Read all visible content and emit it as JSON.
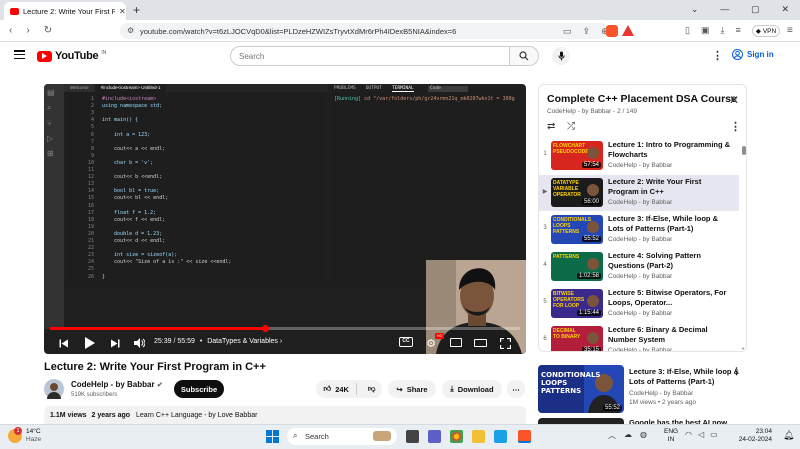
{
  "browser": {
    "tab_title": "Lecture 2: Write Your First Progr",
    "url": "youtube.com/watch?v=t6zLJOCVqD0&list=PLDzeHZWIZsTryvtXdMr6rPh4IDexB5NIA&index=6",
    "vpn_label": "VPN"
  },
  "header": {
    "logo_text": "YouTube",
    "country": "IN",
    "search_placeholder": "Search",
    "signin_label": "Sign in"
  },
  "video": {
    "tabs": [
      "Welcome",
      "#include<iostream> Untitled-1"
    ],
    "code_lines": [
      "#include<iostream>",
      "using namespace std;",
      "",
      "int main() {",
      "",
      "    int a = 123;",
      "",
      "    cout<< a << endl;",
      "",
      "    char b = 'v';",
      "",
      "    cout<< b <<endl;",
      "",
      "    bool bl = true;",
      "    cout<< bl << endl;",
      "",
      "    float f = 1.2;",
      "    cout<< f << endl;",
      "",
      "    double d = 1.23;",
      "    cout<< d << endl;",
      "",
      "    int size = sizeof(a);",
      "    cout<< \"Size of a is :\" << size <<endl;",
      "",
      "}"
    ],
    "panel_tabs": [
      "PROBLEMS",
      "OUTPUT",
      "TERMINAL"
    ],
    "panel_select": "Code",
    "terminal_running": "[Running]",
    "terminal_text": "cd \"/var/folders/ph/gr24vrmn21q_mk0207wkx1t = 300g",
    "time": "25:39 / 55:59",
    "chapter": "DataTypes & Variables",
    "progress": 0.458,
    "title": "Lecture 2: Write Your First Program in C++"
  },
  "channel": {
    "name": "CodeHelp - by Babbar",
    "subs": "519K subscribers",
    "subscribe_label": "Subscribe"
  },
  "actions": {
    "likes": "24K",
    "share_label": "Share",
    "download_label": "Download"
  },
  "description": {
    "views": "1.1M views",
    "age": "2 years ago",
    "text": "Learn C++ Language - by Love Babbar"
  },
  "playlist": {
    "title": "Complete C++ Placement DSA Course",
    "channel": "CodeHelp - by Babbar",
    "position": "2 / 149",
    "items": [
      {
        "index": "1",
        "title": "Lecture 1: Intro to Programming & Flowcharts",
        "channel": "CodeHelp - by Babbar",
        "duration": "57:54",
        "thumb_text": "FLOWCHART PSEUDOCODE",
        "thumb_color": "#d7261e",
        "active": false
      },
      {
        "index": "▶",
        "title": "Lecture 2: Write Your First Program in C++",
        "channel": "CodeHelp - by Babbar",
        "duration": "56:00",
        "thumb_text": "DATATYPE VARIABLE OPERATOR",
        "thumb_color": "#1b1b1b",
        "active": true
      },
      {
        "index": "3",
        "title": "Lecture 3: If-Else, While loop & Lots of Patterns (Part-1)",
        "channel": "CodeHelp - by Babbar",
        "duration": "55:52",
        "thumb_text": "CONDITIONALS LOOPS PATTERNS",
        "thumb_color": "#2447b6",
        "active": false
      },
      {
        "index": "4",
        "title": "Lecture 4: Solving Pattern Questions (Part-2)",
        "channel": "CodeHelp - by Babbar",
        "duration": "1:02:58",
        "thumb_text": "PATTERNS",
        "thumb_color": "#0d6b48",
        "active": false
      },
      {
        "index": "5",
        "title": "Lecture 5: Bitwise Operators, For Loops, Operator...",
        "channel": "CodeHelp - by Babbar",
        "duration": "1:15:44",
        "thumb_text": "BITWISE OPERATORS FOR LOOP",
        "thumb_color": "#3b2a8c",
        "active": false
      },
      {
        "index": "6",
        "title": "Lecture 6: Binary & Decimal Number System",
        "channel": "CodeHelp - by Babbar",
        "duration": "35:15",
        "thumb_text": "DECIMAL TO BINARY",
        "thumb_color": "#b31f3a",
        "active": false
      }
    ]
  },
  "recommended": [
    {
      "title": "Lecture 3: If-Else, While loop & Lots of Patterns (Part-1)",
      "channel": "CodeHelp - by Babbar",
      "views": "1M views",
      "age": "2 years ago",
      "duration": "55:52",
      "thumb_text": "CONDITIONALS LOOPS PATTERNS"
    },
    {
      "title": "Google has the best AI now, but"
    }
  ],
  "taskbar": {
    "weather_temp": "14°C",
    "weather_desc": "Haze",
    "search_label": "Search",
    "lang": "ENG",
    "region": "IN",
    "time": "23:04",
    "date": "24-02-2024",
    "notif": "1"
  },
  "colors": {
    "youtube_red": "#ff0000",
    "link_blue": "#065fd4",
    "active_row": "#e6e6f0"
  }
}
